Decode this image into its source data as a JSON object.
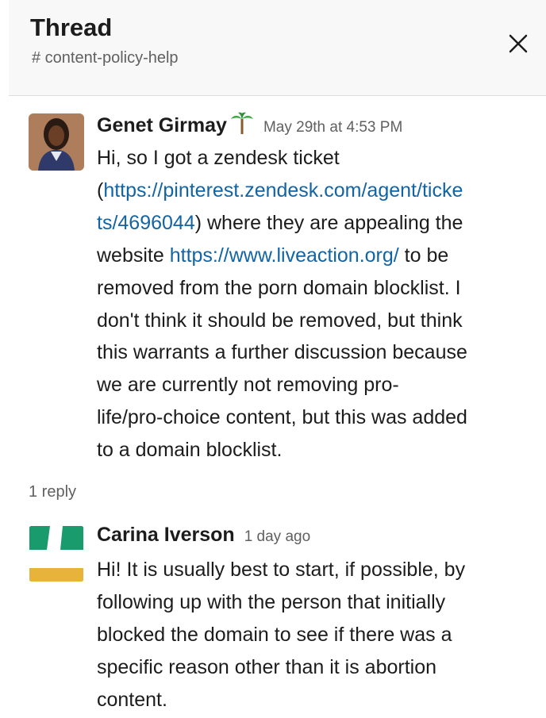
{
  "header": {
    "title": "Thread",
    "channel": "# content-policy-help",
    "close_icon": "close-icon"
  },
  "messages": [
    {
      "author": "Genet Girmay",
      "status_emoji": "palm-tree",
      "timestamp": "May 29th at 4:53 PM",
      "lines": {
        "l1": "Hi, so I got a zendesk ticket",
        "l2_open": "(",
        "l2_link": "https://pinterest.zendesk.com/agent/ticke",
        "l3_link": "ts/4696044",
        "l3_text": ") where they are appealing the",
        "l4_text": "website ",
        "l4_link": "https://www.liveaction.org/",
        "l4_tail": " to be",
        "l5": "removed from the porn domain blocklist. I",
        "l6": "don't think it should be removed, but think",
        "l7": "this warrants a further discussion because",
        "l8": "we are currently not removing pro-",
        "l9": "life/pro-choice content, but this was added",
        "l10": "to a domain blocklist."
      }
    },
    {
      "author": "Carina Iverson",
      "timestamp": "1 day ago",
      "lines": {
        "l1": "Hi! It is usually best to start, if possible, by",
        "l2": "following up with the person that initially",
        "l3": "blocked the domain to see if there was a",
        "l4": "specific reason other than it is abortion",
        "l5": "content."
      }
    }
  ],
  "reply_count": "1 reply",
  "colors": {
    "link": "#1264a3",
    "avatar_green": "#1a9b6d",
    "avatar_yellow": "#e8b33a"
  }
}
